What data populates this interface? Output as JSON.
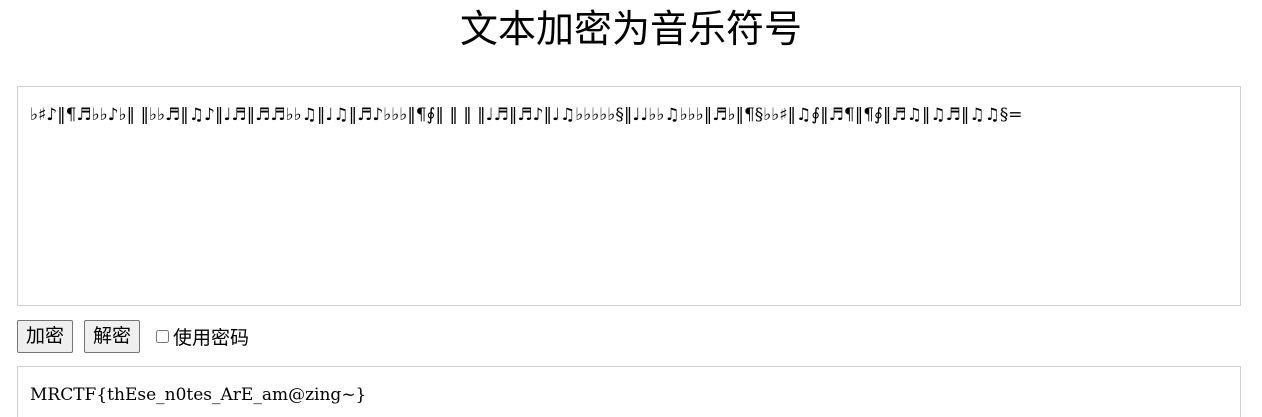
{
  "page": {
    "title": "文本加密为音乐符号"
  },
  "input": {
    "value": "♭♯♪‖¶♬♭♭♪♭‖ ‖♭♭♬‖♫♪‖♩♬‖♬♬♭♭♫‖♩♫‖♬♪♭♭♭‖¶∮‖ ‖ ‖ ‖♩♬‖♬♪‖♩♫♭♭♭♭♭§‖♩♩♭♭♫♭♭♭‖♬♭‖¶§♭♭♯‖♫∮‖♬¶‖¶∮‖♬♫‖♫♬‖♫♫§="
  },
  "controls": {
    "encrypt_label": "加密",
    "decrypt_label": "解密",
    "use_password_label": "使用密码",
    "use_password_checked": false
  },
  "output": {
    "value": "MRCTF{thEse_n0tes_ArE_am@zing~}"
  }
}
